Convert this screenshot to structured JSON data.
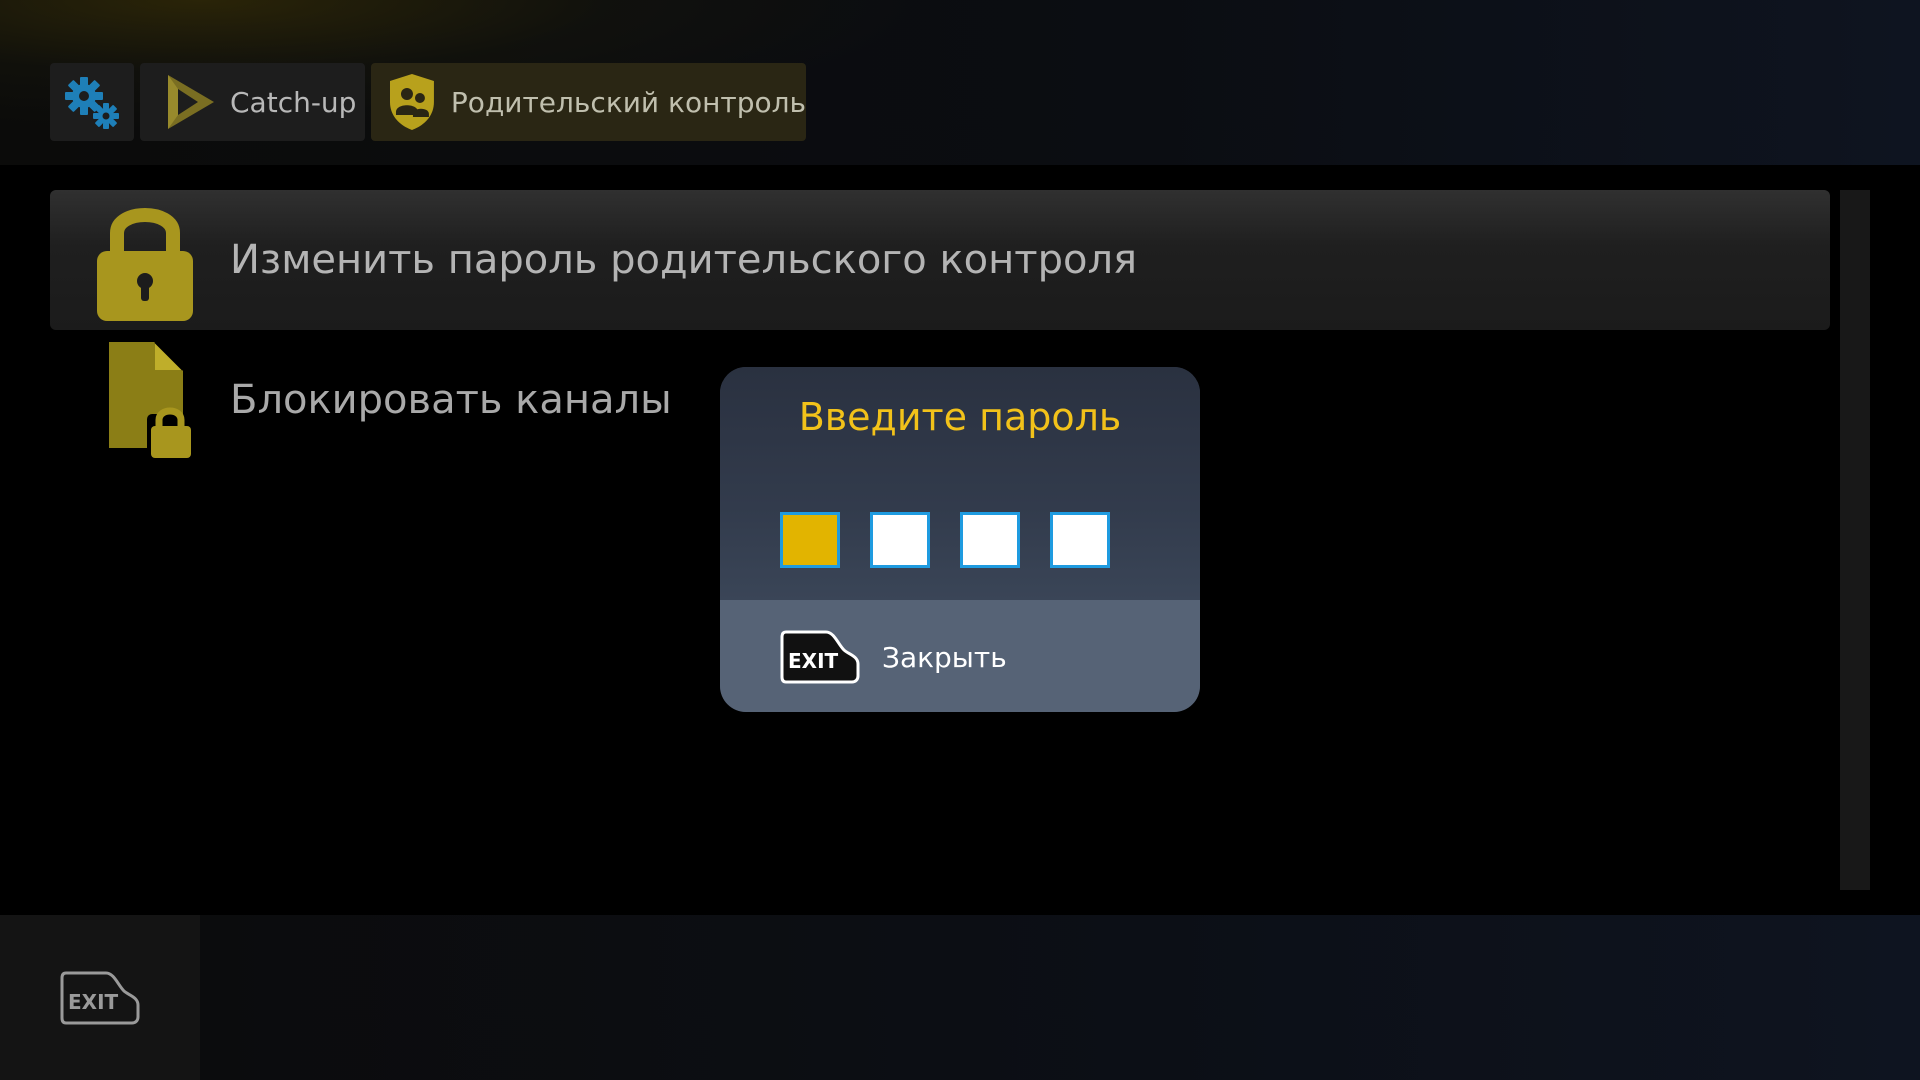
{
  "tabs": [
    {
      "label": "",
      "icon": "gears-icon"
    },
    {
      "label": "Catch-up",
      "icon": "play-icon"
    },
    {
      "label": "Родительский контроль",
      "icon": "parental-shield-icon"
    }
  ],
  "menu": {
    "items": [
      {
        "label": "Изменить пароль родительского контроля",
        "icon": "padlock-icon",
        "selected": true
      },
      {
        "label": "Блокировать каналы",
        "icon": "locked-file-icon",
        "selected": false
      }
    ]
  },
  "dialog": {
    "title": "Введите пароль",
    "pin_length": 4,
    "active_index": 0,
    "close_key": "EXIT",
    "close_label": "Закрыть"
  },
  "footer": {
    "exit_key": "EXIT"
  },
  "colors": {
    "accent_gold": "#f2c21a",
    "icon_gold": "#a8961e",
    "gear_blue": "#1e7fb8",
    "pin_active": "#e2b400",
    "pin_border": "#1e9be0"
  }
}
